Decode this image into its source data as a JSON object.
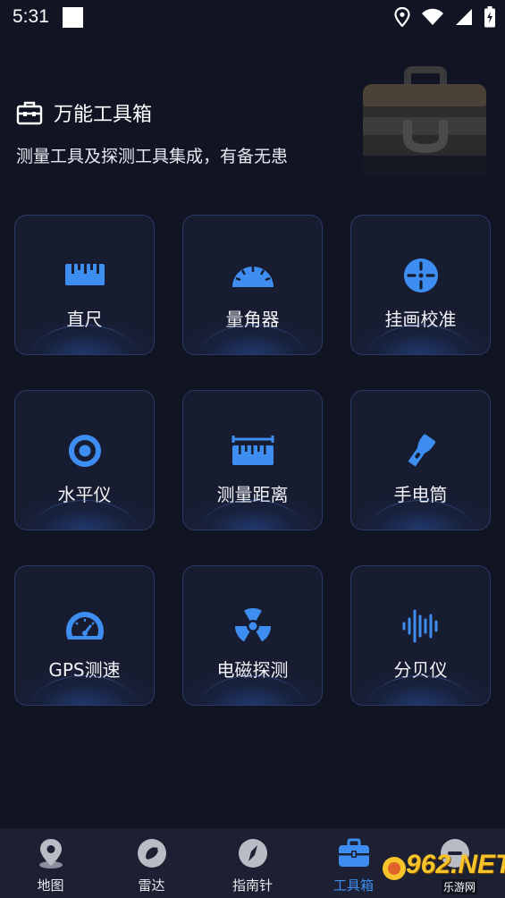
{
  "status_bar": {
    "time": "5:31"
  },
  "header": {
    "title": "万能工具箱",
    "subtitle": "测量工具及探测工具集成，有备无患"
  },
  "tools": [
    {
      "label": "直尺",
      "icon": "ruler-icon"
    },
    {
      "label": "量角器",
      "icon": "protractor-icon"
    },
    {
      "label": "挂画校准",
      "icon": "crosshair-icon"
    },
    {
      "label": "水平仪",
      "icon": "level-icon"
    },
    {
      "label": "测量距离",
      "icon": "distance-ruler-icon"
    },
    {
      "label": "手电筒",
      "icon": "flashlight-icon"
    },
    {
      "label": "GPS测速",
      "icon": "speedometer-icon"
    },
    {
      "label": "电磁探测",
      "icon": "radiation-icon"
    },
    {
      "label": "分贝仪",
      "icon": "soundwave-icon"
    }
  ],
  "bottom_nav": {
    "items": [
      {
        "label": "地图",
        "icon": "map-pin-icon",
        "active": false
      },
      {
        "label": "雷达",
        "icon": "radar-icon",
        "active": false
      },
      {
        "label": "指南针",
        "icon": "compass-icon",
        "active": false
      },
      {
        "label": "工具箱",
        "icon": "toolbox-icon",
        "active": true
      },
      {
        "label": "",
        "icon": "more-icon",
        "active": false
      }
    ]
  },
  "watermark": {
    "brand": "962.NET",
    "sub": "乐游网"
  },
  "colors": {
    "background": "#111423",
    "accent": "#3e8ef2",
    "tile_border": "#2a3a66",
    "nav_bg": "#1c2032"
  }
}
